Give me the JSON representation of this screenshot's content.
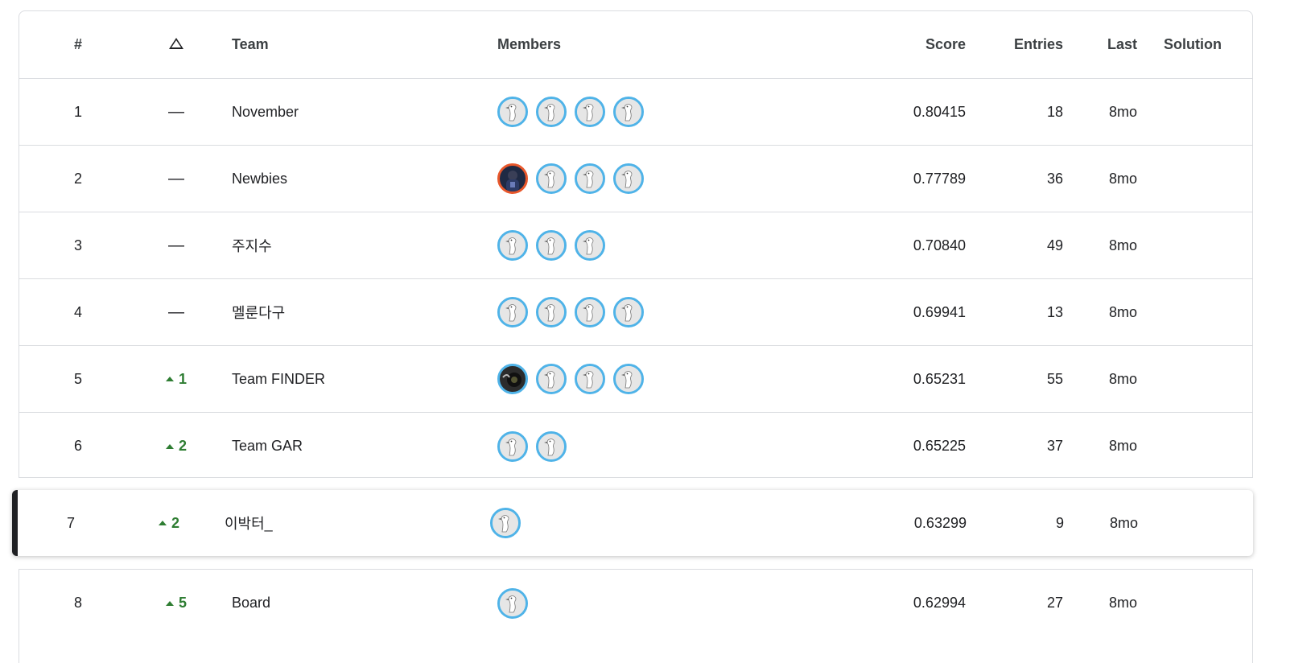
{
  "header": {
    "rank": "#",
    "delta_icon": "delta-triangle-icon",
    "team": "Team",
    "members": "Members",
    "score": "Score",
    "entries": "Entries",
    "last": "Last",
    "solution": "Solution"
  },
  "rows": [
    {
      "rank": "1",
      "delta": "—",
      "delta_dir": "none",
      "team": "November",
      "members": [
        "default",
        "default",
        "default",
        "default"
      ],
      "score": "0.80415",
      "entries": "18",
      "last": "8mo"
    },
    {
      "rank": "2",
      "delta": "—",
      "delta_dir": "none",
      "team": "Newbies",
      "members": [
        "photo-orange",
        "default",
        "default",
        "default"
      ],
      "score": "0.77789",
      "entries": "36",
      "last": "8mo"
    },
    {
      "rank": "3",
      "delta": "—",
      "delta_dir": "none",
      "team": "주지수",
      "members": [
        "default",
        "default",
        "default"
      ],
      "score": "0.70840",
      "entries": "49",
      "last": "8mo"
    },
    {
      "rank": "4",
      "delta": "—",
      "delta_dir": "none",
      "team": "멜룬다구",
      "members": [
        "default",
        "default",
        "default",
        "default"
      ],
      "score": "0.69941",
      "entries": "13",
      "last": "8mo"
    },
    {
      "rank": "5",
      "delta": "1",
      "delta_dir": "up",
      "team": "Team FINDER",
      "members": [
        "photo-dark",
        "default",
        "default",
        "default"
      ],
      "score": "0.65231",
      "entries": "55",
      "last": "8mo"
    },
    {
      "rank": "6",
      "delta": "2",
      "delta_dir": "up",
      "team": "Team GAR",
      "members": [
        "default",
        "default"
      ],
      "score": "0.65225",
      "entries": "37",
      "last": "8mo"
    }
  ],
  "highlight_row": {
    "rank": "7",
    "delta": "2",
    "delta_dir": "up",
    "team": "이박터_",
    "members": [
      "default"
    ],
    "score": "0.63299",
    "entries": "9",
    "last": "8mo"
  },
  "after_rows": [
    {
      "rank": "8",
      "delta": "5",
      "delta_dir": "up",
      "team": "Board",
      "members": [
        "default"
      ],
      "score": "0.62994",
      "entries": "27",
      "last": "8mo"
    }
  ],
  "colors": {
    "avatar_border": "#4fb3e8",
    "up_green": "#2e7d32",
    "orange_border": "#e8572b"
  }
}
